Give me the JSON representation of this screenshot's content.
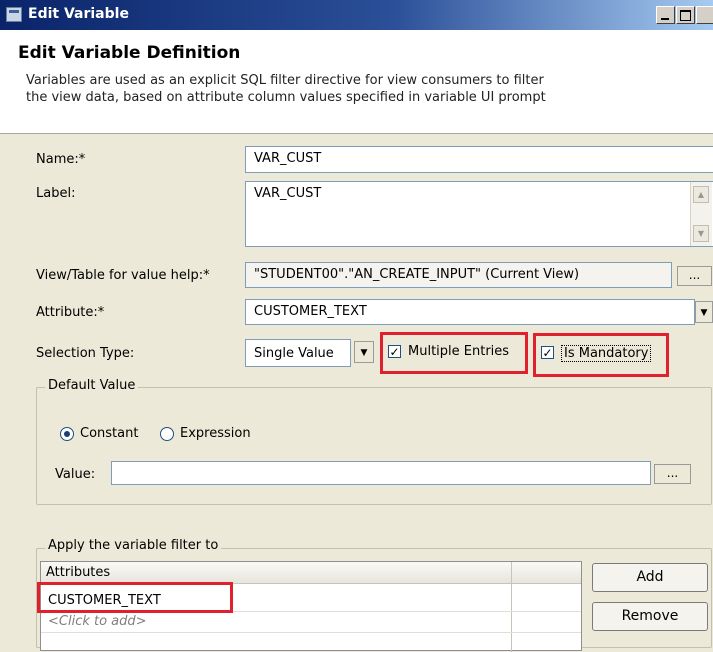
{
  "window": {
    "title": "Edit Variable"
  },
  "header": {
    "title": "Edit Variable Definition",
    "description_line1": "Variables are used as an explicit SQL filter directive for view consumers to filter",
    "description_line2": "the view data, based on attribute column values specified in variable UI prompt"
  },
  "form": {
    "name": {
      "label": "Name:*",
      "value": "VAR_CUST"
    },
    "label_field": {
      "label": "Label:",
      "value": "VAR_CUST"
    },
    "value_help": {
      "label": "View/Table for value help:*",
      "value": "\"STUDENT00\".\"AN_CREATE_INPUT\" (Current View)",
      "button": "..."
    },
    "attribute": {
      "label": "Attribute:*",
      "value": "CUSTOMER_TEXT"
    },
    "selection_type": {
      "label": "Selection Type:",
      "value": "Single Value",
      "multiple_entries": {
        "label": "Multiple Entries",
        "checked": true
      },
      "is_mandatory": {
        "label": "Is Mandatory",
        "checked": true
      }
    }
  },
  "default_value": {
    "legend": "Default Value",
    "constant_label": "Constant",
    "expression_label": "Expression",
    "selected": "Constant",
    "value_label": "Value:",
    "value": "",
    "button": "..."
  },
  "apply_filter": {
    "legend": "Apply the variable filter to",
    "columns": [
      "Attributes",
      ""
    ],
    "rows": [
      {
        "attribute": "CUSTOMER_TEXT"
      }
    ],
    "add_row_placeholder": "<Click to add>",
    "add_button": "Add",
    "remove_button": "Remove"
  },
  "colors": {
    "highlight": "#e0202c",
    "titlebar": "#0a246a"
  }
}
